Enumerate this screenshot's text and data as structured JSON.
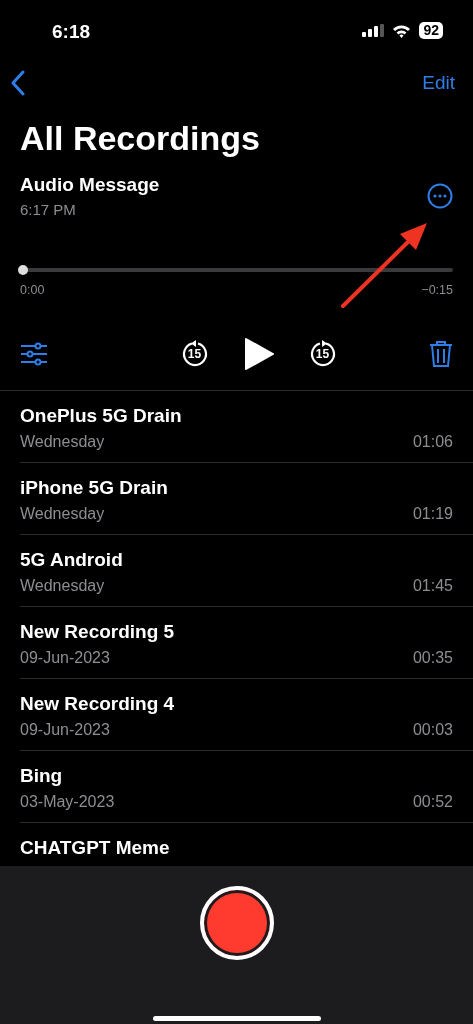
{
  "status_bar": {
    "time": "6:18",
    "battery": "92"
  },
  "nav": {
    "edit": "Edit"
  },
  "title": "All Recordings",
  "current": {
    "name": "Audio Message",
    "time": "6:17 PM",
    "level": 0,
    "elapsed": "0:00",
    "remaining": "−0:15",
    "skip_back": "15",
    "skip_forward": "15"
  },
  "recordings": [
    {
      "name": "OnePlus 5G Drain",
      "date": "Wednesday",
      "duration": "01:06"
    },
    {
      "name": "iPhone 5G Drain",
      "date": "Wednesday",
      "duration": "01:19"
    },
    {
      "name": "5G Android",
      "date": "Wednesday",
      "duration": "01:45"
    },
    {
      "name": "New Recording 5",
      "date": "09-Jun-2023",
      "duration": "00:35"
    },
    {
      "name": "New Recording 4",
      "date": "09-Jun-2023",
      "duration": "00:03"
    },
    {
      "name": "Bing",
      "date": "03-May-2023",
      "duration": "00:52"
    },
    {
      "name": "CHATGPT Meme"
    }
  ]
}
